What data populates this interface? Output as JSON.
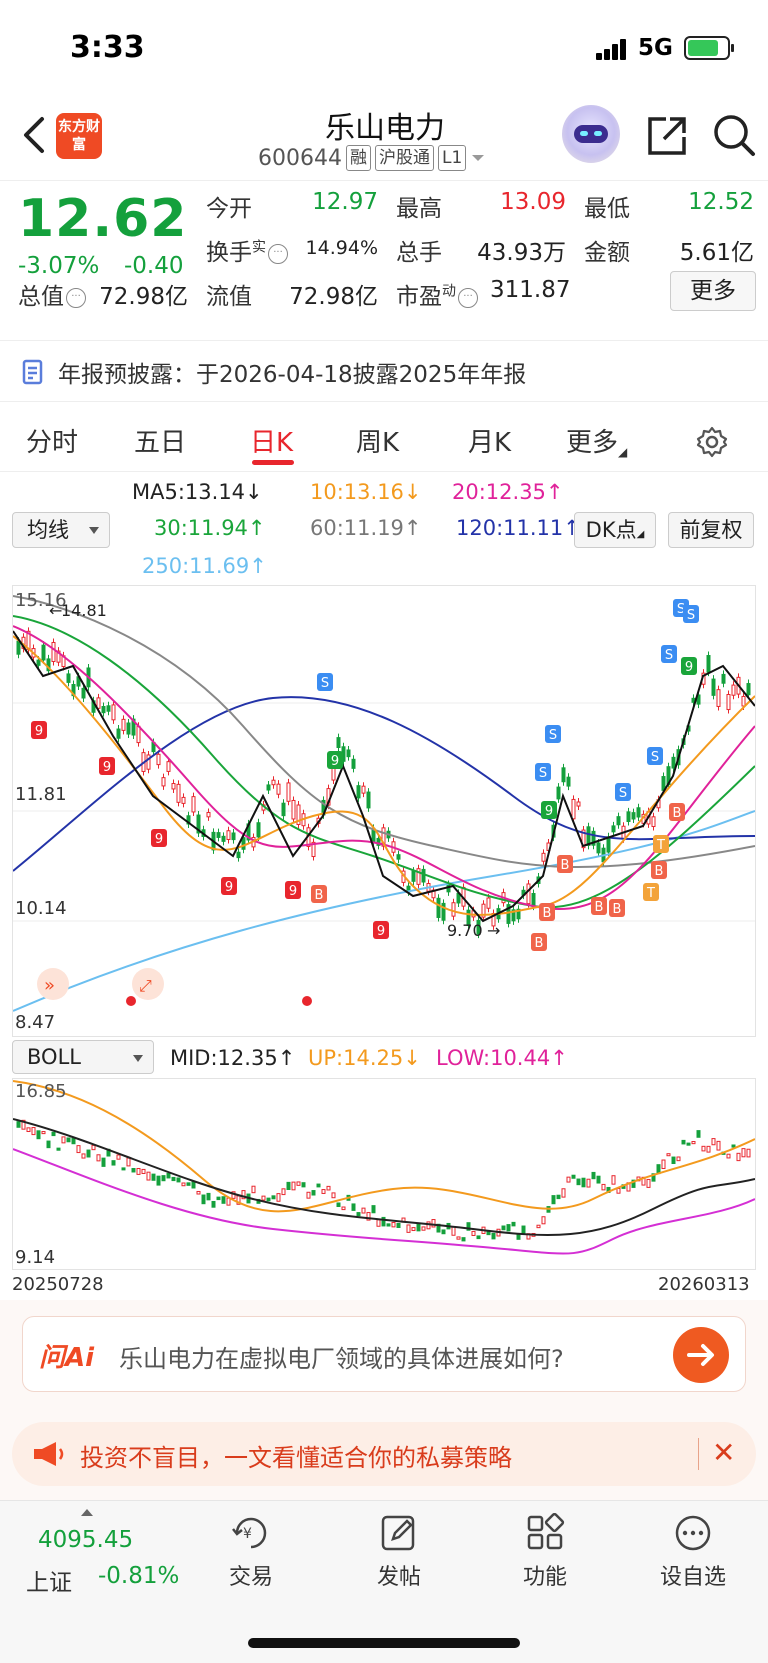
{
  "status_bar": {
    "time": "3:33",
    "network": "5G"
  },
  "header": {
    "logo_text": "东方财富",
    "stock_name": "乐山电力",
    "stock_code": "600644",
    "tags": [
      "融",
      "沪股通",
      "L1"
    ]
  },
  "quote": {
    "price": "12.62",
    "change_pct": "-3.07%",
    "change": "-0.40",
    "fields": {
      "open_label": "今开",
      "open": "12.97",
      "high_label": "最高",
      "high": "13.09",
      "low_label": "最低",
      "low": "12.52",
      "turnover_label": "换手",
      "turnover_sup": "实",
      "turnover": "14.94%",
      "volume_label": "总手",
      "volume": "43.93万",
      "amount_label": "金额",
      "amount": "5.61亿",
      "mktcap_label": "总值",
      "mktcap": "72.98亿",
      "float_label": "流值",
      "float": "72.98亿",
      "pe_label": "市盈",
      "pe_sup": "动",
      "pe": "311.87"
    },
    "more_button": "更多"
  },
  "notice": {
    "text": "年报预披露：于2026-04-18披露2025年年报"
  },
  "tabs": [
    "分时",
    "五日",
    "日K",
    "周K",
    "月K",
    "更多"
  ],
  "active_tab": "日K",
  "indicators": {
    "main_selector": "均线",
    "ma5": "MA5:13.14",
    "ma10": "10:13.16",
    "ma20": "20:12.35",
    "ma30": "30:11.94",
    "ma60": "60:11.19",
    "ma120": "120:11.11",
    "ma250": "250:11.69",
    "dk_button": "DK点",
    "adjust_button": "前复权",
    "colors": {
      "ma5": "#222222",
      "ma10": "#f39a1e",
      "ma20": "#e0229a",
      "ma30": "#1aa53a",
      "ma60": "#888888",
      "ma120": "#2333a8",
      "ma250": "#6bbff0"
    }
  },
  "main_chart": {
    "y_labels": [
      "15.16",
      "11.81",
      "10.14",
      "8.47"
    ],
    "high_marker": "14.81",
    "low_marker": "9.70"
  },
  "sub_chart": {
    "selector": "BOLL",
    "mid": "MID:12.35",
    "up": "UP:14.25",
    "low": "LOW:10.44",
    "y_top": "16.85",
    "y_bottom": "9.14",
    "date_start": "20250728",
    "date_end": "20260313"
  },
  "ask_ai": {
    "logo": "问Ai",
    "question": "乐山电力在虚拟电厂领域的具体进展如何?"
  },
  "banner": {
    "text": "投资不盲目，一文看懂适合你的私募策略"
  },
  "bottom_bar": {
    "index_value": "4095.45",
    "index_name": "上证",
    "index_change": "-0.81%",
    "nav": [
      "交易",
      "发帖",
      "功能",
      "设自选"
    ]
  }
}
